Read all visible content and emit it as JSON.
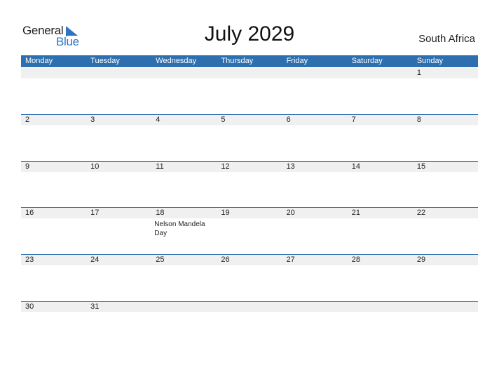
{
  "logo": {
    "line1": "General",
    "line2": "Blue"
  },
  "title": "July 2029",
  "country": "South Africa",
  "weekdays": [
    "Monday",
    "Tuesday",
    "Wednesday",
    "Thursday",
    "Friday",
    "Saturday",
    "Sunday"
  ],
  "colors": {
    "accent": "#2e6fb0",
    "logo_blue": "#2f73c2",
    "day_strip": "#f0f0f0"
  },
  "weeks": [
    [
      {
        "day": ""
      },
      {
        "day": ""
      },
      {
        "day": ""
      },
      {
        "day": ""
      },
      {
        "day": ""
      },
      {
        "day": ""
      },
      {
        "day": "1"
      }
    ],
    [
      {
        "day": "2"
      },
      {
        "day": "3"
      },
      {
        "day": "4"
      },
      {
        "day": "5"
      },
      {
        "day": "6"
      },
      {
        "day": "7"
      },
      {
        "day": "8"
      }
    ],
    [
      {
        "day": "9"
      },
      {
        "day": "10"
      },
      {
        "day": "11"
      },
      {
        "day": "12"
      },
      {
        "day": "13"
      },
      {
        "day": "14"
      },
      {
        "day": "15"
      }
    ],
    [
      {
        "day": "16"
      },
      {
        "day": "17"
      },
      {
        "day": "18",
        "event": "Nelson Mandela Day"
      },
      {
        "day": "19"
      },
      {
        "day": "20"
      },
      {
        "day": "21"
      },
      {
        "day": "22"
      }
    ],
    [
      {
        "day": "23"
      },
      {
        "day": "24"
      },
      {
        "day": "25"
      },
      {
        "day": "26"
      },
      {
        "day": "27"
      },
      {
        "day": "28"
      },
      {
        "day": "29"
      }
    ],
    [
      {
        "day": "30"
      },
      {
        "day": "31"
      },
      {
        "day": ""
      },
      {
        "day": ""
      },
      {
        "day": ""
      },
      {
        "day": ""
      },
      {
        "day": ""
      }
    ]
  ]
}
